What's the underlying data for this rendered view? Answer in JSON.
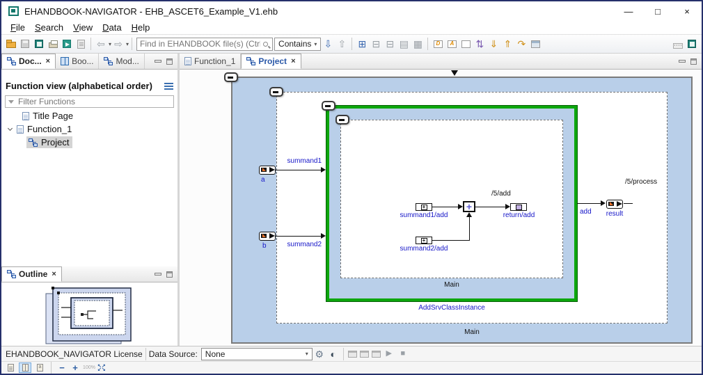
{
  "window": {
    "title": "EHANDBOOK-NAVIGATOR - EHB_ASCET6_Example_V1.ehb",
    "minimize": "—",
    "maximize": "□",
    "close": "×"
  },
  "menu": {
    "items": [
      "File",
      "Search",
      "View",
      "Data",
      "Help"
    ]
  },
  "toolbar": {
    "search_placeholder": "Find in EHANDBOOK file(s) (Ctrl+H)",
    "contains_label": "Contains",
    "icon_names": [
      "open-file",
      "save",
      "open-ehandbook",
      "print",
      "export",
      "report",
      "navigate-back",
      "navigate-forward",
      "find-next",
      "find-previous",
      "expand-hierarchy",
      "collapse-hierarchy",
      "show-list",
      "show-table",
      "model-view-d",
      "model-view-a",
      "model-view-disabled",
      "swap-view",
      "import-values",
      "export-values",
      "model-redo",
      "open-window",
      "keyboard-shortcuts",
      "ehandbook-logo"
    ]
  },
  "glyphs": {
    "caret": "▾",
    "back": "⇦",
    "forward": "⇨",
    "down": "⇩",
    "up": "⇧",
    "expand": "⊞",
    "collapse": "⊟",
    "list": "▤",
    "table": "▦",
    "letter_d": "D",
    "letter_a": "A",
    "swap": "⇅",
    "gold_down": "⇓",
    "gold_up": "⇑",
    "redo": "↷",
    "close": "×",
    "gear": "⚙",
    "contrast": "◐",
    "play": "▶",
    "stop": "■"
  },
  "left_panel": {
    "tabs": [
      {
        "label": "Doc..."
      },
      {
        "label": "Boo..."
      },
      {
        "label": "Mod..."
      }
    ],
    "function_view_title": "Function view (alphabetical order)",
    "filter_placeholder": "Filter Functions",
    "tree": [
      {
        "label": "Title Page"
      },
      {
        "label": "Function_1"
      },
      {
        "label": "Project"
      }
    ]
  },
  "outline": {
    "tab_label": "Outline"
  },
  "editor": {
    "tabs": [
      {
        "label": "Function_1"
      },
      {
        "label": "Project"
      }
    ]
  },
  "diagram": {
    "labels": {
      "summand1": "summand1",
      "summand2": "summand2",
      "a": "a",
      "b": "b",
      "summand1_add": "summand1/add",
      "summand2_add": "summand2/add",
      "return_add": "return/add",
      "add_path": "/5/add",
      "process_path": "/5/process",
      "add": "add",
      "result": "result",
      "inner_main": "Main",
      "instance": "AddSrvClassInstance",
      "outer_main": "Main",
      "plus": "+"
    },
    "colors": {
      "container_fill": "#b9cfe9",
      "selection_green": "#0da60d",
      "label_blue": "#1515c8",
      "wire_black": "#111111"
    }
  },
  "statusbar": {
    "license": "EHANDBOOK_NAVIGATOR License",
    "datasource_label": "Data Source:",
    "datasource_value": "None"
  },
  "zoombar": {
    "zoom_out": "−",
    "zoom_in": "+",
    "zoom_level": "100%",
    "fit_row1": "↖↗",
    "fit_row2": "↙↘"
  }
}
